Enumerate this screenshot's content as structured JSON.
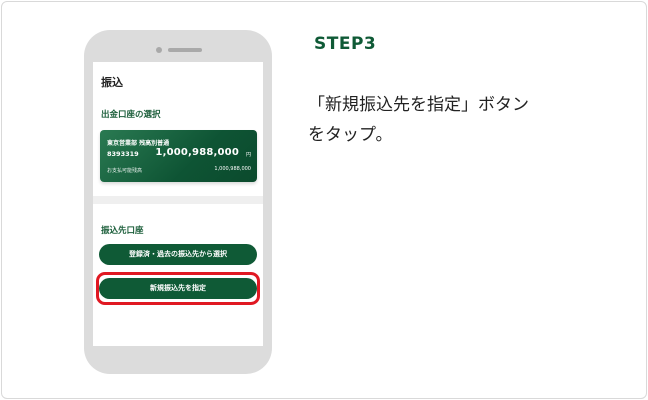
{
  "step": {
    "title": "STEP3"
  },
  "instruction": {
    "line1": "「新規振込先を指定」ボタン",
    "line2": "をタップ。"
  },
  "phone": {
    "screen_title": "振込",
    "source_section_label": "出金口座の選択",
    "account": {
      "branch": "東京営業部 残高別普通",
      "number": "8393319",
      "balance": "1,000,988,000",
      "currency": "円",
      "available_label": "お支払可能残高",
      "available_value": "1,000,988,000"
    },
    "destination_section_label": "振込先口座",
    "buttons": {
      "select_registered": "登録済・過去の振込先から選択",
      "new_destination": "新規振込先を指定"
    }
  },
  "colors": {
    "brand_green": "#0f5a36",
    "highlight_red": "#e01822",
    "phone_body": "#dcdcdc"
  }
}
